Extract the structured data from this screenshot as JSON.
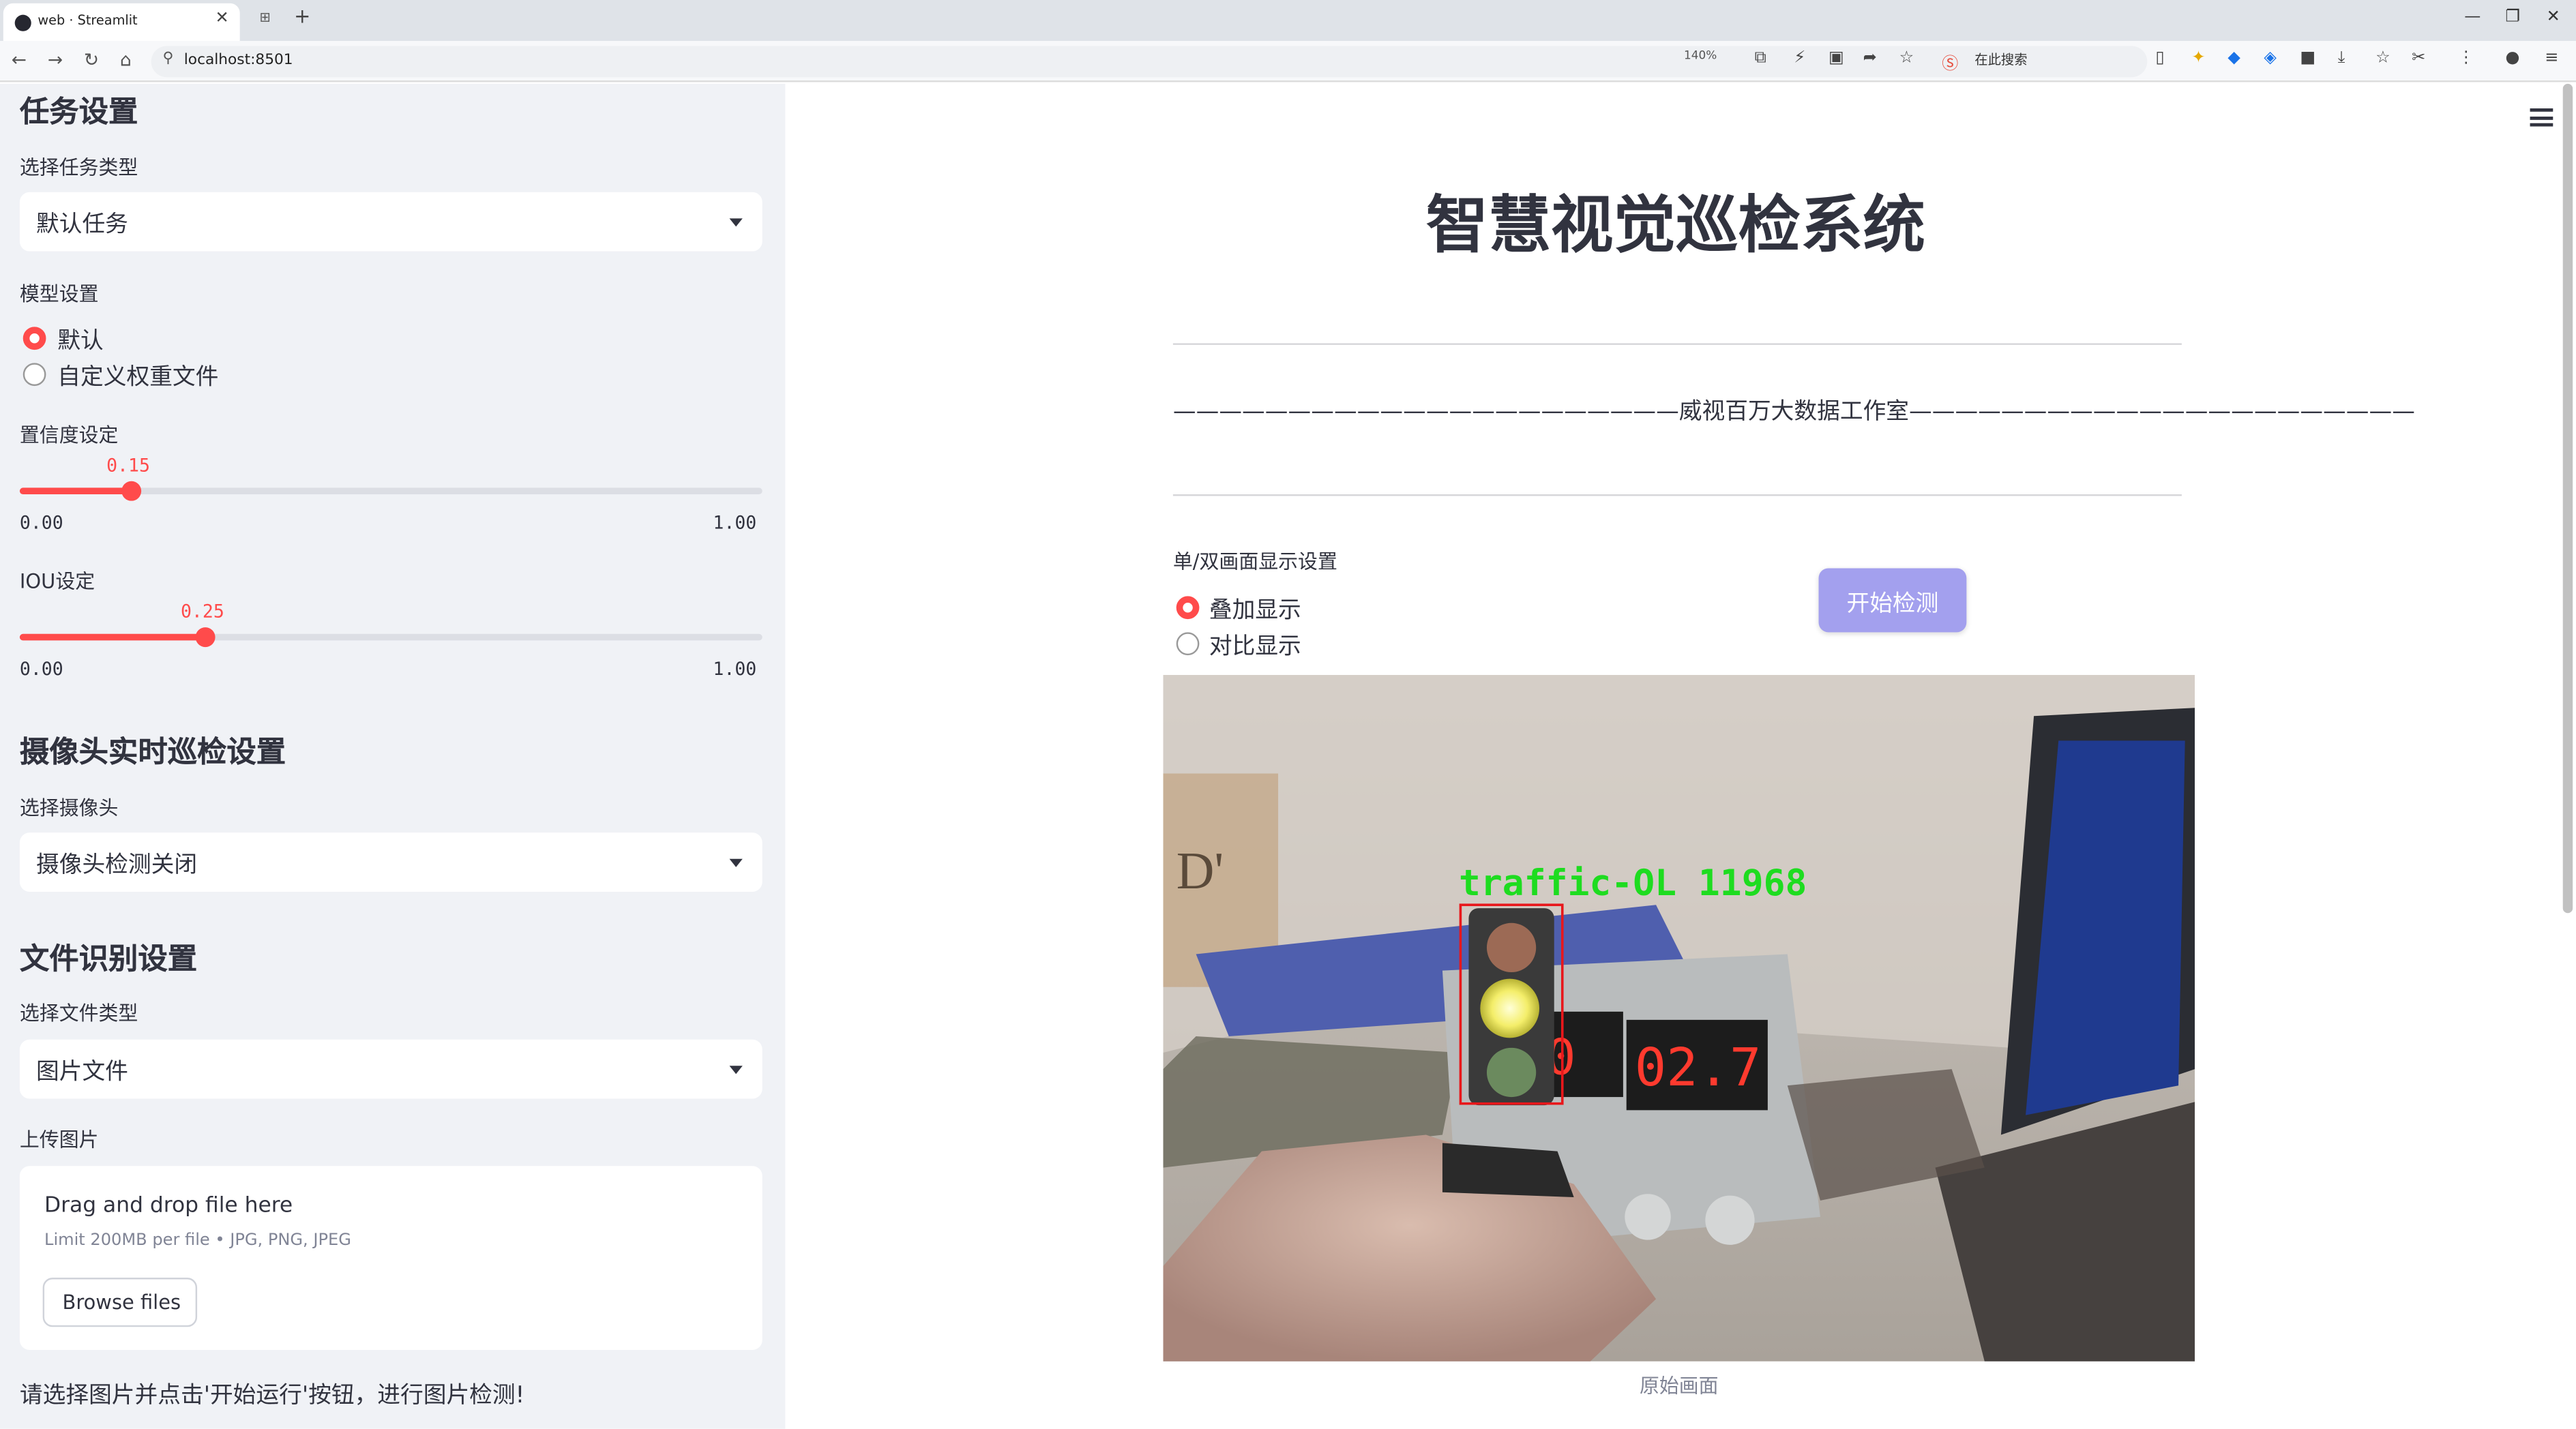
{
  "browser": {
    "tab_title": "web · Streamlit",
    "url": "localhost:8501",
    "zoom": "140%",
    "search_placeholder": "在此搜索"
  },
  "sidebar": {
    "task_heading": "任务设置",
    "task_type_label": "选择任务类型",
    "task_type_value": "默认任务",
    "model_label": "模型设置",
    "model_options": [
      "默认",
      "自定义权重文件"
    ],
    "model_selected": 0,
    "conf_label": "置信度设定",
    "conf_value": "0.15",
    "conf_fraction": 0.15,
    "conf_min": "0.00",
    "conf_max": "1.00",
    "iou_label": "IOU设定",
    "iou_value": "0.25",
    "iou_fraction": 0.25,
    "iou_min": "0.00",
    "iou_max": "1.00",
    "camera_heading": "摄像头实时巡检设置",
    "camera_label": "选择摄像头",
    "camera_value": "摄像头检测关闭",
    "file_heading": "文件识别设置",
    "file_type_label": "选择文件类型",
    "file_type_value": "图片文件",
    "upload_label": "上传图片",
    "upload_title": "Drag and drop file here",
    "upload_limit": "Limit 200MB per file • JPG, PNG, JPEG",
    "browse_label": "Browse files",
    "hint": "请选择图片并点击'开始运行'按钮，进行图片检测!"
  },
  "main": {
    "title": "智慧视觉巡检系统",
    "subtitle": "——————————————————————威视百万大数据工作室——————————————————————",
    "display_label": "单/双画面显示设置",
    "display_options": [
      "叠加显示",
      "对比显示"
    ],
    "display_selected": 0,
    "start_button": "开始检测",
    "detection_label": "traffic-OL 11968",
    "caption": "原始画面"
  },
  "colors": {
    "accent": "#ff4b4b",
    "sidebar_bg": "#f0f2f6",
    "button_bg": "#a3a0ee",
    "box": "#e8171b",
    "box_label": "#1edc20"
  }
}
